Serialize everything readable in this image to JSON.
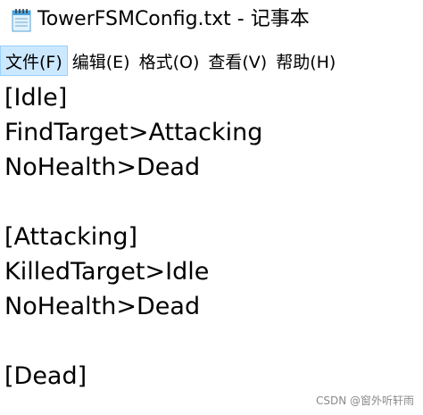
{
  "window": {
    "title": "TowerFSMConfig.txt - 记事本",
    "icon": "notepad-icon"
  },
  "menu": {
    "items": [
      {
        "label": "文件(F)"
      },
      {
        "label": "编辑(E)"
      },
      {
        "label": "格式(O)"
      },
      {
        "label": "查看(V)"
      },
      {
        "label": "帮助(H)"
      }
    ]
  },
  "editor": {
    "lines": [
      "[Idle]",
      "FindTarget>Attacking",
      "NoHealth>Dead",
      "",
      "[Attacking]",
      "KilledTarget>Idle",
      "NoHealth>Dead",
      "",
      "[Dead]"
    ]
  },
  "watermark": "CSDN @窗外听轩雨",
  "colors": {
    "menu_highlight": "#cce8ff",
    "menu_highlight_border": "#99d1ff",
    "watermark": "#8a8a8a"
  }
}
